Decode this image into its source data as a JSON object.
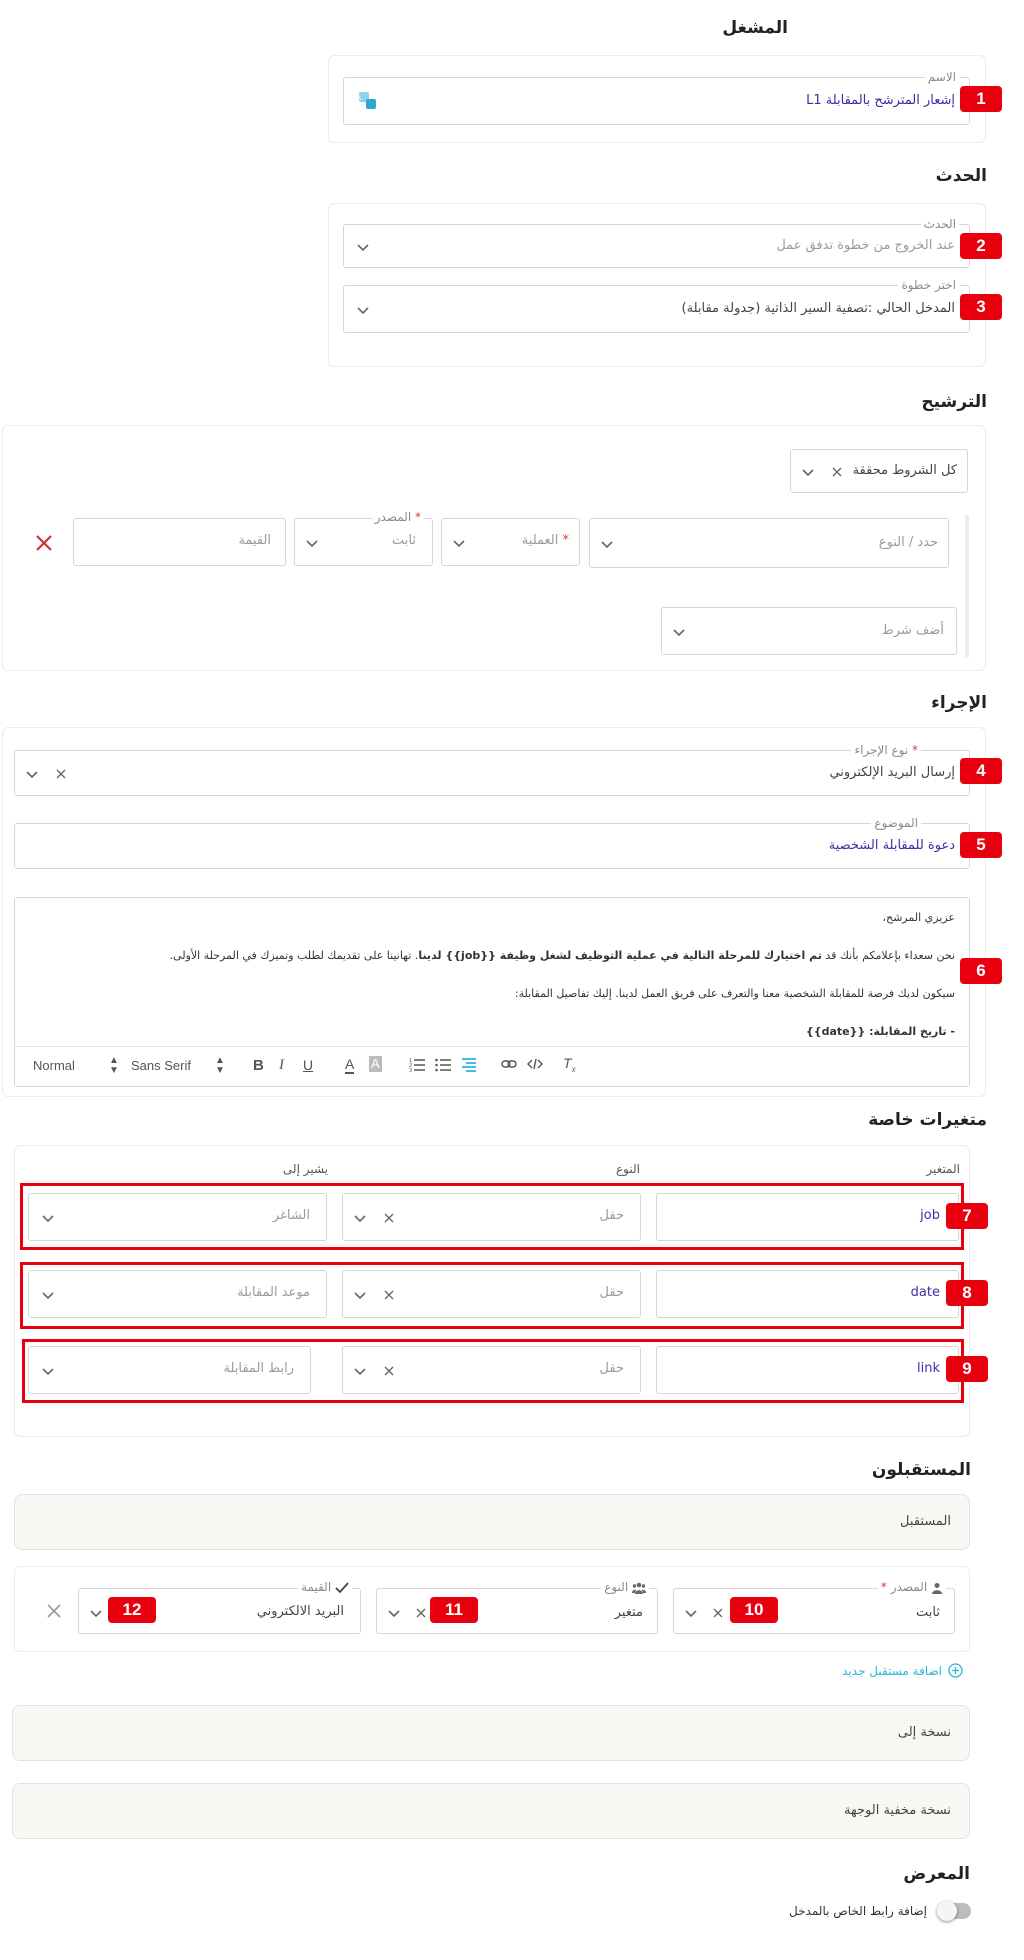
{
  "trigger": {
    "heading": "المشغل",
    "name_label": "الاسم",
    "name_value": "إشعار المترشح بالمقابلة L1"
  },
  "event": {
    "heading": "الحدث",
    "event_label": "الحدث",
    "event_value": "عند الخروج من خطوة تدفق عمل",
    "step_label": "اختر خطوة",
    "step_value": "المدخل الحالي :تصفية السير الذاتية (جدولة مقابلة)"
  },
  "filter": {
    "heading": "الترشيح",
    "condition_mode": "كل الشروط محققة",
    "type_placeholder": "حدد / النوع",
    "operation_label": "العملية",
    "source_label": "المصدر",
    "source_value": "ثابت",
    "value_placeholder": "القيمة",
    "add_condition": "أضف شرط"
  },
  "action": {
    "heading": "الإجراء",
    "type_label": "نوع الإجراء",
    "type_value": "إرسال البريد الإلكتروني",
    "subject_label": "الموضوع",
    "subject_value": "دعوة للمقابلة الشخصية",
    "body": {
      "greeting": "عزيزي المرشح،",
      "p1_a": "نحن سعداء بإعلامكم بأنك قد ",
      "p1_b": "تم اختيارك للمرحلة التالية في عملية التوظيف لشغل وظيفة {{job}} لدينا",
      "p1_c": ". تهانينا على تقديمك لطلب وتميزك في المرحلة الأولى.",
      "p2": "سيكون لديك فرصة للمقابلة الشخصية معنا والتعرف على فريق العمل لدينا. إليك تفاصيل المقابلة:",
      "p3": "- تاريخ المقابلة: {{date}}"
    },
    "toolbar": {
      "size": "Normal",
      "font": "Sans Serif"
    }
  },
  "custom_vars": {
    "heading": "متغيرات خاصة",
    "col_variable": "المتغير",
    "col_type": "النوع",
    "col_points_to": "يشير إلى",
    "rows": [
      {
        "variable": "job",
        "type": "حقل",
        "target": "الشاغر"
      },
      {
        "variable": "date",
        "type": "حقل",
        "target": "موعد المقابلة"
      },
      {
        "variable": "link",
        "type": "حقل",
        "target": "رابط المقابلة"
      }
    ]
  },
  "recipients": {
    "heading": "المستقبلون",
    "recipient_title": "المستقبل",
    "source_label": "المصدر",
    "source_value": "ثابت",
    "type_label": "النوع",
    "type_value": "متغير",
    "value_label": "القيمة",
    "value_value": "البريد الالكتروني",
    "add_recipient": "اضافة مستقبل جديد",
    "cc": "نسخة إلى",
    "bcc": "نسخة مخفية الوجهة"
  },
  "display": {
    "heading": "المعرض",
    "toggle_label": "إضافة رابط الخاص بالمدخل"
  },
  "badges": [
    "1",
    "2",
    "3",
    "4",
    "5",
    "6",
    "7",
    "8",
    "9",
    "10",
    "11",
    "12"
  ],
  "colors": {
    "badge": "#e8000f",
    "link": "#3a2fa8",
    "accent": "#29b6d8"
  }
}
